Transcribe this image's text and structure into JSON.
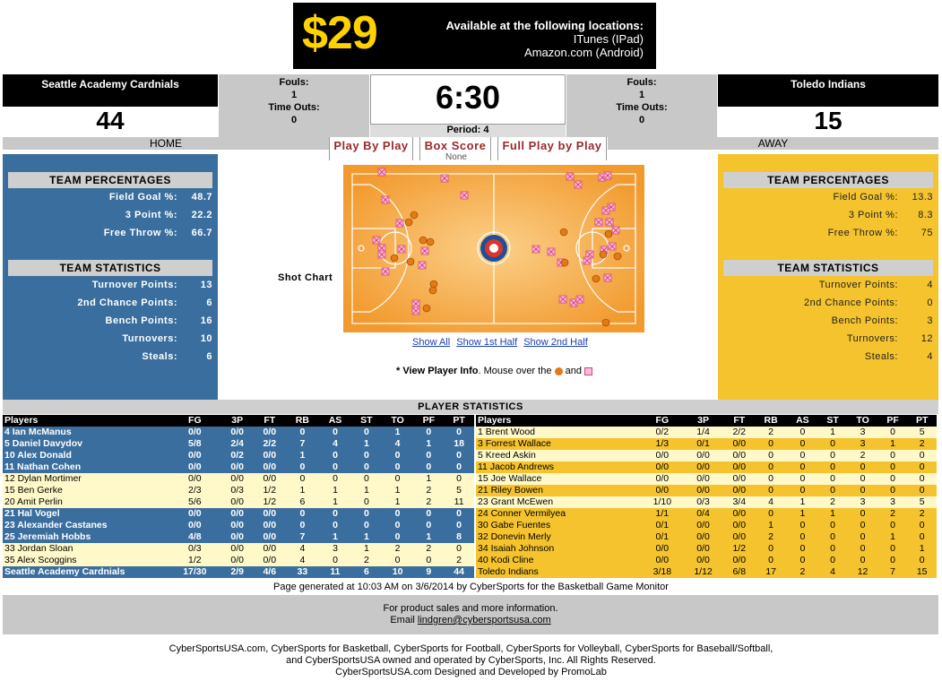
{
  "ad": {
    "price": "$29",
    "heading": "Available at the following locations:",
    "line1": "ITunes (IPad)",
    "line2": "Amazon.com (Android)"
  },
  "home": {
    "name": "Seattle Academy Cardnials",
    "score": "44",
    "label": "HOME",
    "fouls_label": "Fouls:",
    "fouls": "1",
    "timeouts_label": "Time Outs:",
    "timeouts": "0"
  },
  "away": {
    "name": "Toledo Indians",
    "score": "15",
    "label": "AWAY",
    "fouls_label": "Fouls:",
    "fouls": "1",
    "timeouts_label": "Time Outs:",
    "timeouts": "0"
  },
  "clock": "6:30",
  "period": "Period: 4",
  "tabs": [
    "Play By Play",
    "Box Score",
    "Full Play by Play"
  ],
  "tab_none": "None",
  "home_stats": {
    "pct_title": "TEAM PERCENTAGES",
    "pct": [
      {
        "label": "Field Goal %:",
        "value": "48.7"
      },
      {
        "label": "3 Point %:",
        "value": "22.2"
      },
      {
        "label": "Free Throw %:",
        "value": "66.7"
      }
    ],
    "team_title": "TEAM STATISTICS",
    "team": [
      {
        "label": "Turnover Points:",
        "value": "13"
      },
      {
        "label": "2nd Chance Points:",
        "value": "6"
      },
      {
        "label": "Bench Points:",
        "value": "16"
      },
      {
        "label": "Turnovers:",
        "value": "10"
      },
      {
        "label": "Steals:",
        "value": "6"
      }
    ]
  },
  "away_stats": {
    "pct_title": "TEAM PERCENTAGES",
    "pct": [
      {
        "label": "Field Goal %:",
        "value": "13.3"
      },
      {
        "label": "3 Point %:",
        "value": "8.3"
      },
      {
        "label": "Free Throw %:",
        "value": "75"
      }
    ],
    "team_title": "TEAM STATISTICS",
    "team": [
      {
        "label": "Turnover Points:",
        "value": "4"
      },
      {
        "label": "2nd Chance Points:",
        "value": "0"
      },
      {
        "label": "Bench Points:",
        "value": "3"
      },
      {
        "label": "Turnovers:",
        "value": "12"
      },
      {
        "label": "Steals:",
        "value": "4"
      }
    ]
  },
  "shot_chart_label": "Shot Chart",
  "shot_links": [
    "Show All",
    "Show 1st Half",
    "Show 2nd Half"
  ],
  "hint": {
    "bold": "* View Player Info",
    "text": ". Mouse over the",
    "and": "and"
  },
  "player_stats_title": "PLAYER STATISTICS",
  "columns": [
    "Players",
    "FG",
    "3P",
    "FT",
    "RB",
    "AS",
    "ST",
    "TO",
    "PF",
    "PT"
  ],
  "home_players": [
    [
      "4 Ian McManus",
      "0/0",
      "0/0",
      "0/0",
      "0",
      "0",
      "0",
      "1",
      "0",
      "0"
    ],
    [
      "5 Daniel Davydov",
      "5/8",
      "2/4",
      "2/2",
      "7",
      "4",
      "1",
      "4",
      "1",
      "18"
    ],
    [
      "10 Alex Donald",
      "0/0",
      "0/2",
      "0/0",
      "1",
      "0",
      "0",
      "0",
      "0",
      "0"
    ],
    [
      "11 Nathan Cohen",
      "0/0",
      "0/0",
      "0/0",
      "0",
      "0",
      "0",
      "0",
      "0",
      "0"
    ],
    [
      "12 Dylan Mortimer",
      "0/0",
      "0/0",
      "0/0",
      "0",
      "0",
      "0",
      "0",
      "1",
      "0"
    ],
    [
      "15 Ben Gerke",
      "2/3",
      "0/3",
      "1/2",
      "1",
      "1",
      "1",
      "1",
      "2",
      "5"
    ],
    [
      "20 Amit Perlin",
      "5/6",
      "0/0",
      "1/2",
      "6",
      "1",
      "0",
      "1",
      "2",
      "11"
    ],
    [
      "21 Hal Vogel",
      "0/0",
      "0/0",
      "0/0",
      "0",
      "0",
      "0",
      "0",
      "0",
      "0"
    ],
    [
      "23 Alexander Castanes",
      "0/0",
      "0/0",
      "0/0",
      "0",
      "0",
      "0",
      "0",
      "0",
      "0"
    ],
    [
      "25 Jeremiah Hobbs",
      "4/8",
      "0/0",
      "0/0",
      "7",
      "1",
      "1",
      "0",
      "1",
      "8"
    ],
    [
      "33 Jordan Sloan",
      "0/3",
      "0/0",
      "0/0",
      "4",
      "3",
      "1",
      "2",
      "2",
      "0"
    ],
    [
      "35 Alex Scoggins",
      "1/2",
      "0/0",
      "0/0",
      "4",
      "0",
      "2",
      "0",
      "0",
      "2"
    ]
  ],
  "home_total": [
    "Seattle Academy Cardnials",
    "17/30",
    "2/9",
    "4/6",
    "33",
    "11",
    "6",
    "10",
    "9",
    "44"
  ],
  "away_players": [
    [
      "1 Brent Wood",
      "0/2",
      "1/4",
      "2/2",
      "2",
      "0",
      "1",
      "3",
      "0",
      "5"
    ],
    [
      "3 Forrest Wallace",
      "1/3",
      "0/1",
      "0/0",
      "0",
      "0",
      "0",
      "3",
      "1",
      "2"
    ],
    [
      "5 Kreed Askin",
      "0/0",
      "0/0",
      "0/0",
      "0",
      "0",
      "0",
      "2",
      "0",
      "0"
    ],
    [
      "11 Jacob Andrews",
      "0/0",
      "0/0",
      "0/0",
      "0",
      "0",
      "0",
      "0",
      "0",
      "0"
    ],
    [
      "15 Joe Wallace",
      "0/0",
      "0/0",
      "0/0",
      "0",
      "0",
      "0",
      "0",
      "0",
      "0"
    ],
    [
      "21 Riley Bowen",
      "0/0",
      "0/0",
      "0/0",
      "0",
      "0",
      "0",
      "0",
      "0",
      "0"
    ],
    [
      "23 Grant McEwen",
      "1/10",
      "0/3",
      "3/4",
      "4",
      "1",
      "2",
      "3",
      "3",
      "5"
    ],
    [
      "24 Conner Vermilyea",
      "1/1",
      "0/4",
      "0/0",
      "0",
      "1",
      "1",
      "0",
      "2",
      "2"
    ],
    [
      "30 Gabe Fuentes",
      "0/1",
      "0/0",
      "0/0",
      "1",
      "0",
      "0",
      "0",
      "0",
      "0"
    ],
    [
      "32 Donevin Merly",
      "0/1",
      "0/0",
      "0/0",
      "2",
      "0",
      "0",
      "0",
      "1",
      "0"
    ],
    [
      "34 Isaiah Johnson",
      "0/0",
      "0/0",
      "1/2",
      "0",
      "0",
      "0",
      "0",
      "0",
      "1"
    ],
    [
      "40 Kodi Cline",
      "0/0",
      "0/0",
      "0/0",
      "0",
      "0",
      "0",
      "0",
      "0",
      "0"
    ]
  ],
  "away_total": [
    "Toledo Indians",
    "3/18",
    "1/12",
    "6/8",
    "17",
    "2",
    "4",
    "12",
    "7",
    "15"
  ],
  "generated": "Page generated at 10:03 AM on 3/6/2014 by CyberSports for the Basketball Game Monitor",
  "contact": {
    "line1": "For product sales and more information.",
    "email_label": "Email",
    "email": "lindgren@cybersportsusa.com"
  },
  "footer": {
    "line1": "CyberSportsUSA.com, CyberSports for Basketball, CyberSports for Football, CyberSports for Volleyball, CyberSports for Baseball/Softball,",
    "line2": "and CyberSportsUSA owned and operated by CyberSports, Inc. All Rights Reserved.",
    "line3": "CyberSportsUSA.com Designed and Developed by PromoLab"
  },
  "colors": {
    "home": "#3a6e9e",
    "away": "#f5c32d",
    "ad_price": "#ffd200",
    "tab_text": "#9b2a2a",
    "court": "#f6a640"
  },
  "shots": {
    "made_icon": "orange-ball-icon",
    "missed_icon": "pink-x-icon"
  }
}
